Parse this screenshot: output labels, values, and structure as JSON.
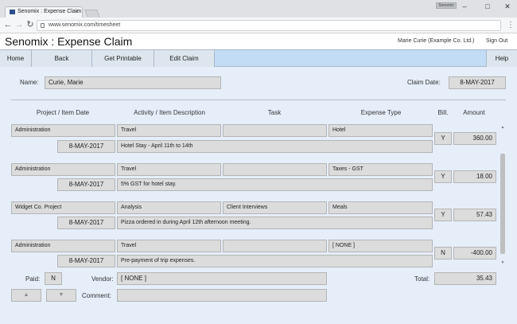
{
  "browser": {
    "tab_title": "Senomix : Expense Claim",
    "tab_close": "×",
    "user_badge": "Senomix",
    "minimize": "–",
    "maximize": "□",
    "close": "✕",
    "back": "←",
    "forward": "→",
    "reload": "↻",
    "url": "www.senomix.com/timesheet",
    "menu": "⋮"
  },
  "app": {
    "title": "Senomix : Expense Claim",
    "user": "Marie Curie   (Example Co. Ltd.)",
    "sign_out": "Sign Out"
  },
  "nav": {
    "home": "Home",
    "back": "Back",
    "get_printable": "Get Printable",
    "edit_claim": "Edit Claim",
    "help": "Help"
  },
  "claim": {
    "name_label": "Name:",
    "name": "Curie, Marie",
    "date_label": "Claim Date:",
    "date": "8-MAY-2017"
  },
  "columns": {
    "project": "Project / Item Date",
    "activity": "Activity / Item Description",
    "task": "Task",
    "expense_type": "Expense Type",
    "billable": "Bill.",
    "amount": "Amount"
  },
  "rows": [
    {
      "project": "Administration",
      "date": "8-MAY-2017",
      "activity": "Travel",
      "description": "Hotel Stay - April 11th to 14th",
      "task": "",
      "expense_type": "Hotel",
      "billable": "Y",
      "amount": "360.00"
    },
    {
      "project": "Administration",
      "date": "8-MAY-2017",
      "activity": "Travel",
      "description": "5% GST for hotel stay.",
      "task": "",
      "expense_type": "Taxes - GST",
      "billable": "Y",
      "amount": "18.00"
    },
    {
      "project": "Widget Co. Project",
      "date": "8-MAY-2017",
      "activity": "Analysis",
      "description": "Pizza ordered in during April 12th afternoon meeting.",
      "task": "Client Interviews",
      "expense_type": "Meals",
      "billable": "Y",
      "amount": "57.43"
    },
    {
      "project": "Administration",
      "date": "8-MAY-2017",
      "activity": "Travel",
      "description": "Pre-payment of trip expenses.",
      "task": "",
      "expense_type": "[ NONE ]",
      "billable": "N",
      "amount": "-400.00"
    }
  ],
  "footer": {
    "paid_label": "Paid:",
    "paid": "N",
    "vendor_label": "Vendor:",
    "vendor": "[ NONE ]",
    "total_label": "Total:",
    "total": "35.43",
    "comment_label": "Comment:",
    "comment": "",
    "up_arrow": "▲",
    "down_arrow": "▼"
  },
  "colors": {
    "nav_bar": "#c2dcf6",
    "content_bg": "#e6eefa",
    "field_bg": "#dcdcdc"
  }
}
